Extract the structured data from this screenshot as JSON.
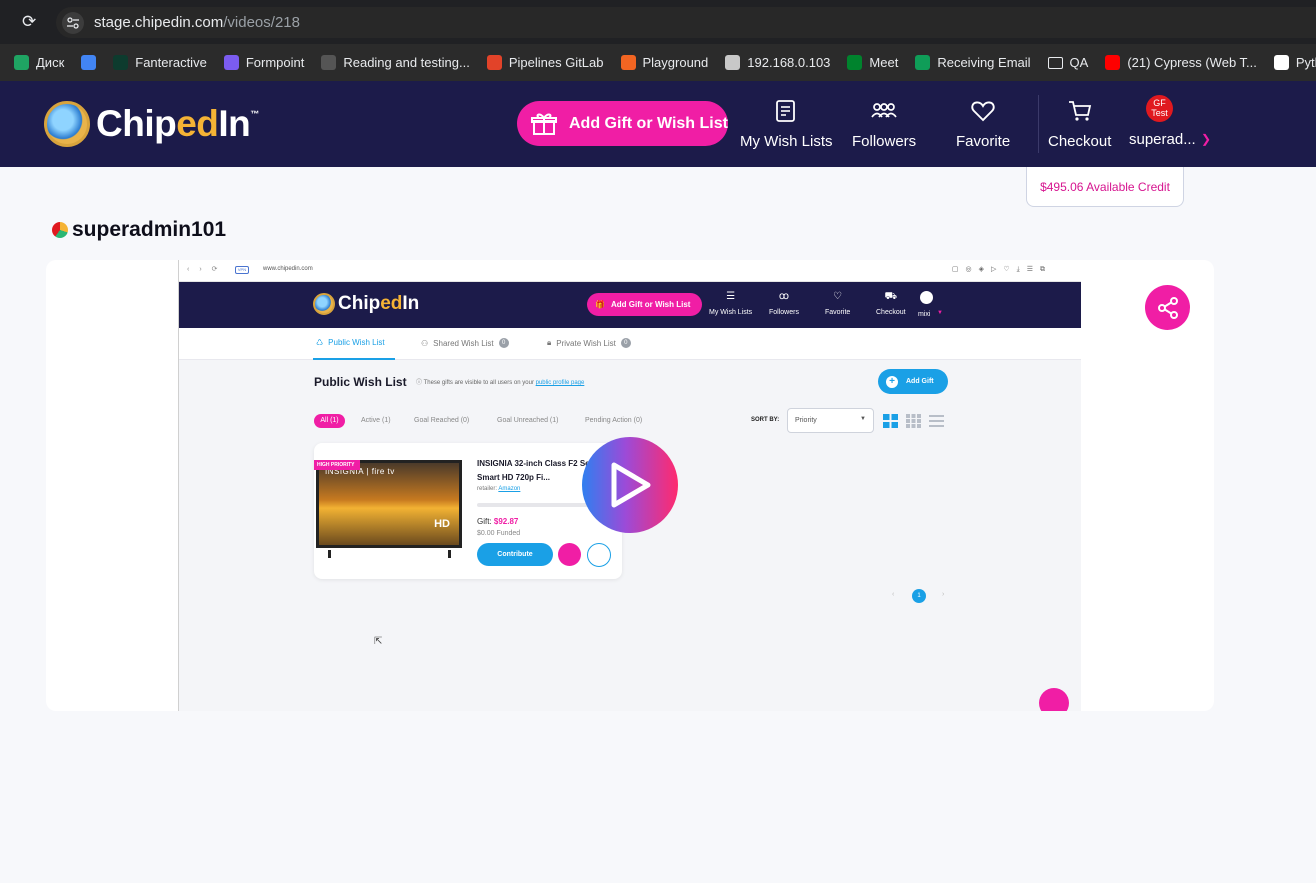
{
  "browser": {
    "url_host": "stage.chipedin.com",
    "url_path": "/videos/218",
    "bookmarks": [
      {
        "label": "Диск",
        "color": "#1fa463"
      },
      {
        "label": "",
        "color": "#4285f4"
      },
      {
        "label": "Fanteractive",
        "color": "#0d3b2e"
      },
      {
        "label": "Formpoint",
        "color": "#7b5cf0"
      },
      {
        "label": "Reading and testing...",
        "color": "#555555"
      },
      {
        "label": "Pipelines GitLab",
        "color": "#e24329"
      },
      {
        "label": "Playground",
        "color": "#f26522"
      },
      {
        "label": "192.168.0.103",
        "color": "#c8c8c8"
      },
      {
        "label": "Meet",
        "color": "#00832d"
      },
      {
        "label": "Receiving Email",
        "color": "#0f9d58"
      },
      {
        "label": "QA",
        "color": "folder"
      },
      {
        "label": "(21) Cypress (Web T...",
        "color": "#ff0000"
      },
      {
        "label": "PythonStepik",
        "color": "#ffffff"
      }
    ]
  },
  "header": {
    "logo_pre": "Chip",
    "logo_ed": "ed",
    "logo_post": "In",
    "logo_tm": "™",
    "add_gift_label": "Add Gift or Wish List",
    "nav": {
      "wishlists": "My Wish Lists",
      "followers": "Followers",
      "favorite": "Favorite",
      "checkout": "Checkout"
    },
    "avatar_text": "GF Test",
    "user_name": "superad...",
    "available_credit": "$495.06 Available Credit"
  },
  "page": {
    "username": "superadmin101"
  },
  "video": {
    "mini_url": "www.chipedin.com",
    "vpn": "VPN",
    "add_gift": "Add Gift or Wish List",
    "nav": [
      "My Wish Lists",
      "Followers",
      "Favorite",
      "Checkout"
    ],
    "user": "mixi",
    "tabs": [
      {
        "label": "Public Wish List",
        "count": ""
      },
      {
        "label": "Shared Wish List",
        "count": "0"
      },
      {
        "label": "Private Wish List",
        "count": "0"
      }
    ],
    "title": "Public Wish List",
    "subtitle_pre": "These gifts are visible to all users on your",
    "subtitle_link": "public profile page",
    "add_gift_btn": "Add Gift",
    "filters": [
      "All (1)",
      "Active (1)",
      "Goal Reached (0)",
      "Goal Unreached (1)",
      "Pending Action (0)"
    ],
    "sort_label": "SORT BY:",
    "sort_value": "Priority",
    "product": {
      "priority": "HIGH PRIORITY",
      "tv_brand": "INSIGNIA | fire tv",
      "tv_hd": "HD",
      "name": "INSIGNIA 32-inch Class F2 Series Smart HD 720p Fi...",
      "retailer_label": "retailer:",
      "retailer": "Amazon",
      "gift_label": "Gift:",
      "gift_price": "$92.87",
      "funded": "$0.00 Funded",
      "contribute": "Contribute",
      "progress": 0
    },
    "page_number": "1"
  }
}
